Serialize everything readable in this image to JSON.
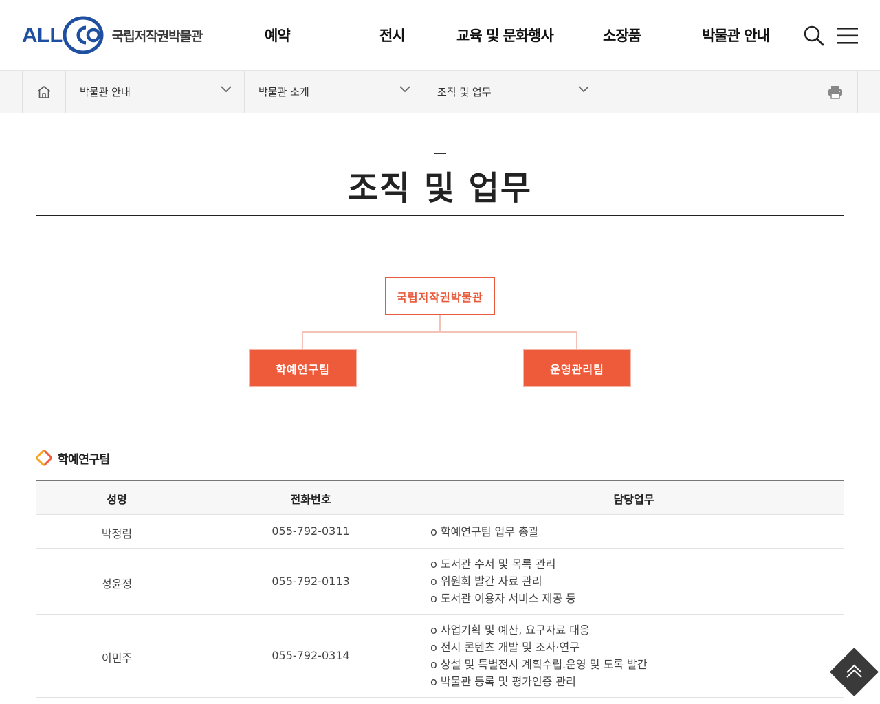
{
  "header": {
    "logo_text": "ALL",
    "logo_ring_letters": "CO",
    "logo_sub": "국립저작권박물관",
    "gnb": [
      "예약",
      "전시",
      "교육 및 문화행사",
      "소장품",
      "박물관 안내"
    ],
    "search_icon": "search-icon",
    "menu_icon": "hamburger-icon"
  },
  "location": {
    "home_icon": "home-icon",
    "depth1": "박물관 안내",
    "depth2": "박물관 소개",
    "depth3": "조직 및 업무",
    "print_icon": "printer-icon"
  },
  "page": {
    "title": "조직 및 업무"
  },
  "org_chart": {
    "top": "국립저작권박물관",
    "teams": [
      "학예연구팀",
      "운영관리팀"
    ]
  },
  "section": {
    "title": "학예연구팀"
  },
  "table": {
    "headers": [
      "성명",
      "전화번호",
      "담당업무"
    ],
    "rows": [
      {
        "name": "박정림",
        "phone": "055-792-0311",
        "duties": [
          "o 학예연구팀 업무 총괄"
        ]
      },
      {
        "name": "성윤정",
        "phone": "055-792-0113",
        "duties": [
          "o 도서관 수서 및 목록 관리",
          "o 위원회 발간 자료 관리",
          "o 도서관 이용자 서비스 제공 등"
        ]
      },
      {
        "name": "이민주",
        "phone": "055-792-0314",
        "duties": [
          "o 사업기획 및 예산, 요구자료 대응",
          "o 전시 콘텐츠 개발 및 조사·연구",
          "o 상설 및 특별전시 계획수립.운영 및 도록 발간",
          "o 박물관 등록 및 평가인증 관리"
        ]
      }
    ]
  },
  "colors": {
    "brand_blue": "#1f4fa0",
    "accent_orange": "#ee5b3b"
  }
}
